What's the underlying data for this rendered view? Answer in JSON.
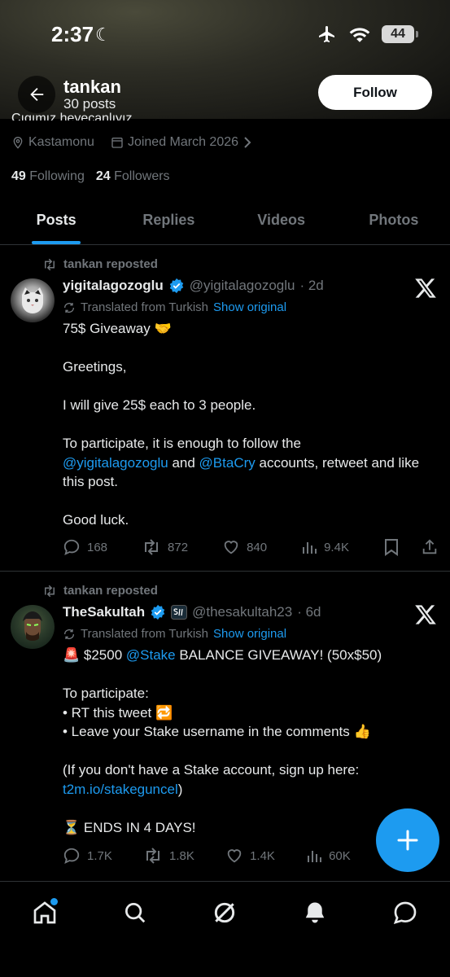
{
  "status": {
    "time": "2:37",
    "battery": "44"
  },
  "header": {
    "name": "tankan",
    "posts_count": "30 posts",
    "follow_label": "Follow"
  },
  "profile": {
    "bio_cut": "Çıgımız heyecanlıyız",
    "location": "Kastamonu",
    "joined": "Joined March 2026",
    "following_count": "49",
    "following_label": "Following",
    "followers_count": "24",
    "followers_label": "Followers"
  },
  "tabs": [
    "Posts",
    "Replies",
    "Videos",
    "Photos"
  ],
  "posts": [
    {
      "repost_label": "tankan reposted",
      "name": "yigitalagozoglu",
      "handle": "@yigitalagozoglu",
      "time": "· 2d",
      "translated": "Translated from Turkish",
      "show_original": "Show original",
      "lines": {
        "l1": "75$ Giveaway 🤝",
        "l2": "Greetings,",
        "l3": "I will give 25$ each to 3 people.",
        "l4a": "To participate, it is enough to follow the",
        "mention1": "@yigitalagozoglu",
        "and": " and ",
        "mention2": "@BtaCry",
        "l4b": " accounts, retweet and like this post.",
        "l5": "Good luck."
      },
      "stats": {
        "replies": "168",
        "reposts": "872",
        "likes": "840",
        "views": "9.4K"
      }
    },
    {
      "repost_label": "tankan reposted",
      "name": "TheSakultah",
      "handle": "@thesakultah23",
      "time": "· 6d",
      "translated": "Translated from Turkish",
      "show_original": "Show original",
      "lines": {
        "l1a": "🚨 $2500 ",
        "mention": "@Stake",
        "l1b": " BALANCE GIVEAWAY! (50x$50)",
        "l2": "To participate:",
        "l3": "• RT this tweet 🔁",
        "l4": "• Leave your Stake username in the comments 👍",
        "l5": "(If you don't have a Stake account, sign up here:",
        "link": "t2m.io/stakeguncel",
        "l5b": ")",
        "l6": "⏳ ENDS IN 4 DAYS!"
      },
      "stats": {
        "replies": "1.7K",
        "reposts": "1.8K",
        "likes": "1.4K",
        "views": "60K"
      }
    }
  ],
  "colors": {
    "accent": "#1d9bf0",
    "muted": "#71767b",
    "text": "#e7e9ea",
    "bg": "#000000"
  }
}
